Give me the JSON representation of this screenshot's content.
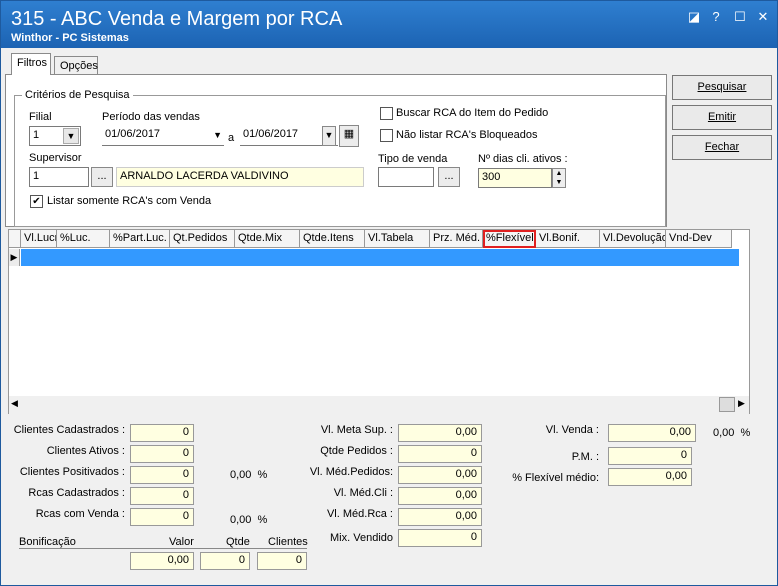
{
  "window": {
    "title": "315 - ABC Venda e Margem por RCA",
    "subtitle": "Winthor - PC Sistemas",
    "accent": "#1c63b3"
  },
  "tabs": [
    {
      "label": "Filtros"
    },
    {
      "label": "Opções"
    }
  ],
  "criteria": {
    "legend": "Critérios de Pesquisa",
    "filial_label": "Filial",
    "filial_value": "1",
    "periodo_label": "Período das vendas",
    "date_from": "01/06/2017",
    "a_label": "a",
    "date_to": "01/06/2017",
    "supervisor_label": "Supervisor",
    "supervisor_code": "1",
    "supervisor_name": "ARNALDO LACERDA VALDIVINO",
    "ellipsis": "...",
    "buscar_rca": "Buscar RCA do Item do Pedido",
    "nao_listar": "Não listar RCA's Bloqueados",
    "tipo_venda_label": "Tipo de venda",
    "tipo_venda_value": "",
    "dias_label": "Nº dias cli. ativos :",
    "dias_value": "300",
    "listar_somente": "Listar somente RCA's com Venda"
  },
  "actions": {
    "pesquisar": "Pesquisar",
    "emitir": "Emitir",
    "fechar": "Fechar"
  },
  "grid": {
    "columns": [
      "Vl.Lucro",
      "%Luc.",
      "%Part.Luc.",
      "Qt.Pedidos",
      "Qtde.Mix",
      "Qtde.Itens",
      "Vl.Tabela",
      "Prz. Méd.",
      "%Flexível",
      "Vl.Bonif.",
      "Vl.Devolução",
      "Vnd-Dev"
    ],
    "highlight_color": "#e02020",
    "selection_color": "#3399ff"
  },
  "summary": {
    "clientes_cadastrados": {
      "label": "Clientes Cadastrados :",
      "value": "0"
    },
    "clientes_ativos": {
      "label": "Clientes Ativos :",
      "value": "0"
    },
    "clientes_positivados": {
      "label": "Clientes Positivados :",
      "value": "0",
      "pct": "0,00  %"
    },
    "rcas_cadastrados": {
      "label": "Rcas Cadastrados :",
      "value": "0"
    },
    "rcas_com_venda": {
      "label": "Rcas com Venda :",
      "value": "0",
      "pct": "0,00  %"
    },
    "bonificacao": {
      "label": "Bonificação",
      "valor_label": "Valor",
      "qtde_label": "Qtde",
      "clientes_label": "Clientes",
      "valor": "0,00",
      "qtde": "0",
      "clientes": "0"
    },
    "meta_sup": {
      "label": "Vl. Meta Sup. :",
      "value": "0,00"
    },
    "qtde_pedidos": {
      "label": "Qtde Pedidos :",
      "value": "0"
    },
    "med_pedidos": {
      "label": "Vl. Méd.Pedidos:",
      "value": "0,00"
    },
    "med_cli": {
      "label": "Vl. Méd.Cli :",
      "value": "0,00"
    },
    "med_rca": {
      "label": "Vl. Méd.Rca :",
      "value": "0,00"
    },
    "mix_vendido": {
      "label": "Mix. Vendido",
      "value": "0"
    },
    "vl_venda": {
      "label": "Vl. Venda :",
      "value": "0,00",
      "pct": "0,00  %"
    },
    "pm": {
      "label": "P.M. :",
      "value": "0"
    },
    "flex_medio": {
      "label": "% Flexível médio:",
      "value": "0,00"
    }
  }
}
